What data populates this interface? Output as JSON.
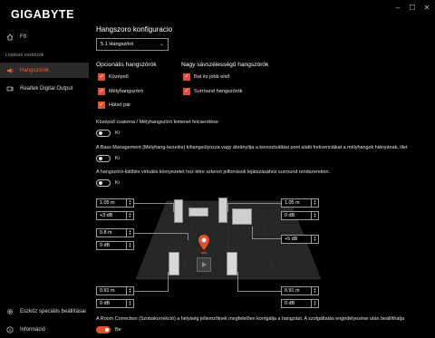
{
  "app": {
    "logo": "GIGABYTE",
    "window_controls": [
      "–",
      "☐",
      "✕"
    ]
  },
  "sidebar": {
    "home_label": "Fő",
    "section_label": "Lejátszó eszközök",
    "devices": [
      {
        "label": "Hangszórók",
        "icon": "speaker-icon",
        "active": true
      },
      {
        "label": "Realtek Digital Output",
        "icon": "digital-output-icon",
        "active": false
      }
    ],
    "advanced_label": "Eszköz speciális beállításai",
    "info_label": "Információ"
  },
  "main": {
    "config_title": "Hangszoro konfiguracio",
    "config_select": "5.1 Hangszóró",
    "optional_title": "Opcionális hangszórók",
    "optional_items": [
      "Középső",
      "Mélyhangszóró",
      "Hátsó pár"
    ],
    "fullrange_title": "Nagy sávszélességű hangszórók",
    "fullrange_items": [
      "Bal és jobb első",
      "Surround hangszórók"
    ],
    "swap_text": "Középső csatorna / Mélyhangszóró kimenet felcserélése",
    "swap_state": "Ki",
    "bass_text": "A Bass Management (Mélyhang-kezelés) kihangsúlyozza vagy átirányítja a keresztváltási pont alatti frekvenciákat a mélyhangok hiányának, illet",
    "bass_state": "Ki",
    "virtual_text": "A hangszóró-kitöltés virtuális környezetet hoz létre sztereó jelforrások lejátszásához surround rendszereken.",
    "virtual_state": "Ki",
    "room_text": "A Room Correction (Szobakorrekció) a helyiség jellemzőinek megfelelően korrigálja a hangzást. A szolgáltatás engedélyezése után beállíthatja",
    "room_state": "Be"
  },
  "speaker_controls": {
    "front_left": {
      "distance": "1.05 m",
      "gain": "+3 dB"
    },
    "front_right": {
      "distance": "1.05 m",
      "gain": "0 dB"
    },
    "center": {
      "distance": "0.8 m",
      "gain": "0 dB"
    },
    "subwoofer": {
      "gain": "+5 dB"
    },
    "rear_left": {
      "distance": "0.91 m",
      "gain": "0 dB"
    },
    "rear_right": {
      "distance": "0.91 m",
      "gain": "0 dB"
    }
  },
  "colors": {
    "accent": "#e0512f",
    "background": "#000000",
    "active_nav": "#2b2b2b"
  }
}
